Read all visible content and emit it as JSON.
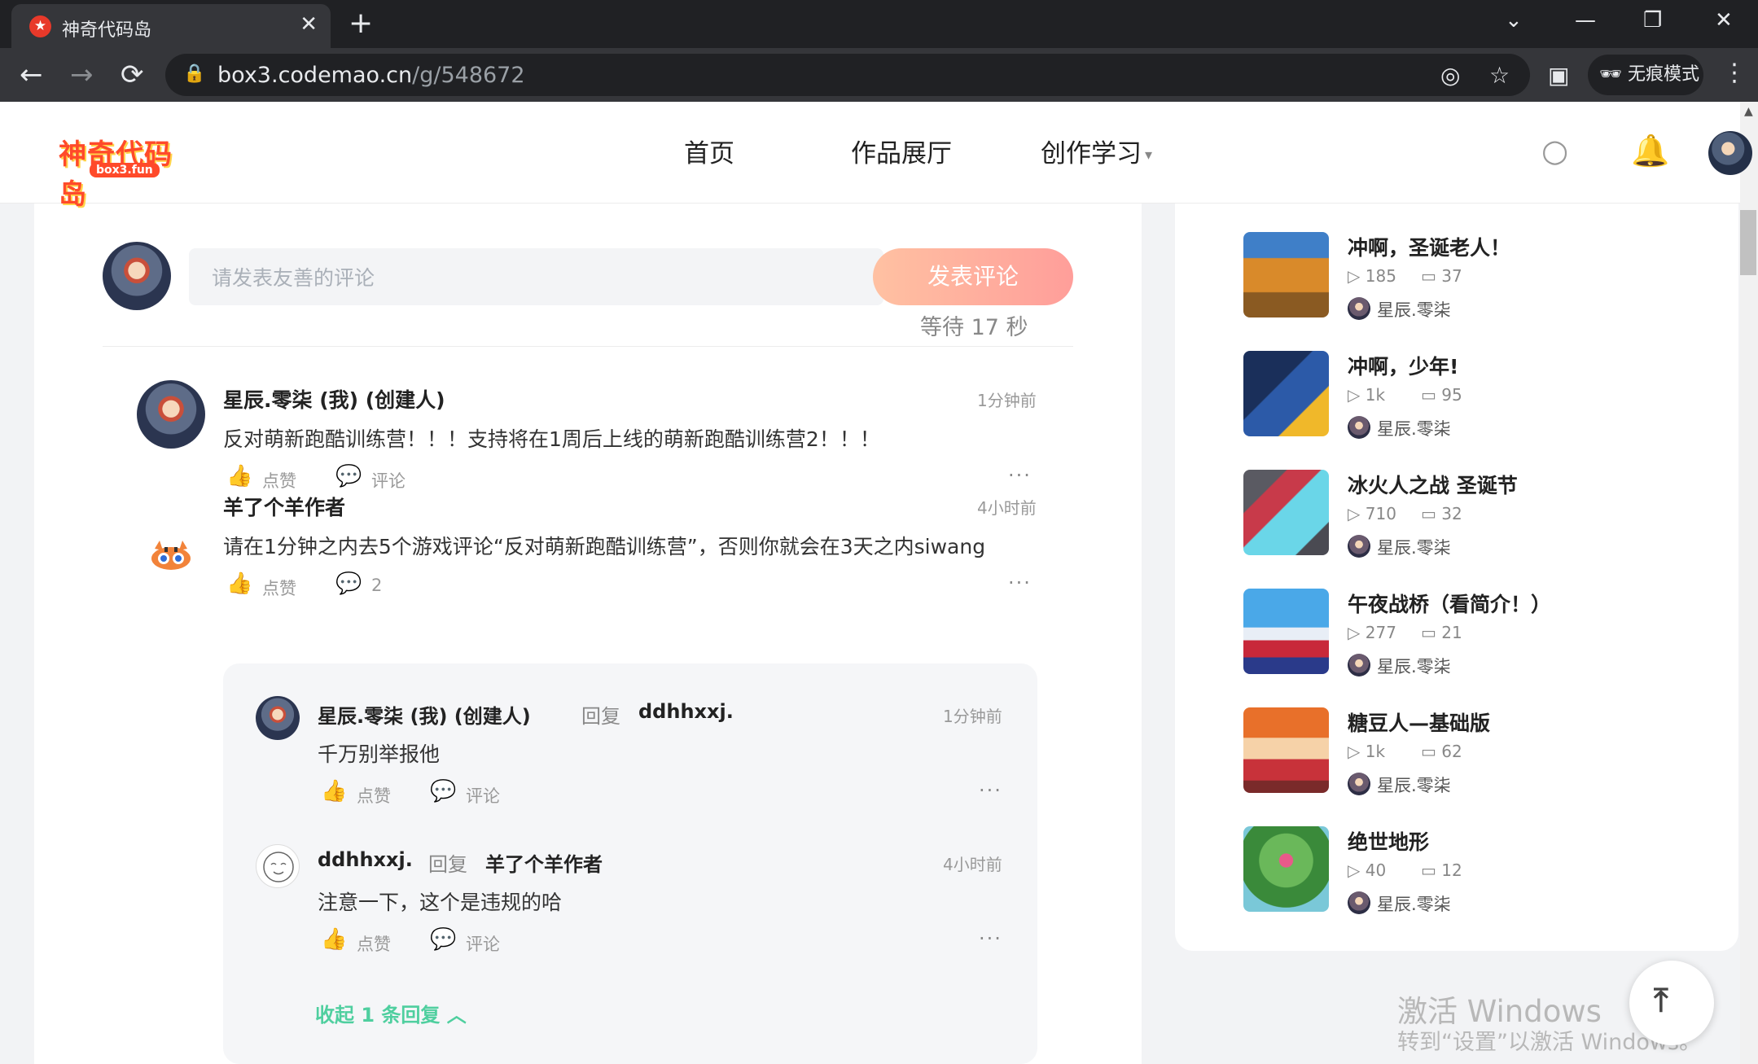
{
  "browser": {
    "tab_title": "神奇代码岛",
    "tab_favicon": "★",
    "new_tab": "+",
    "close_tab": "✕",
    "url_host": "box3.codemao.cn",
    "url_path": "/g/548672",
    "incognito_label": "无痕模式",
    "window_controls": {
      "chevron": "⌄",
      "minimize": "—",
      "restore": "❐",
      "close": "✕"
    },
    "nav": {
      "back": "←",
      "forward": "→",
      "reload": "⟳"
    }
  },
  "header": {
    "logo_text": "神奇代码岛",
    "logo_sub": "box3.fun",
    "nav": [
      {
        "label": "首页"
      },
      {
        "label": "作品展厅"
      },
      {
        "label": "创作学习"
      }
    ],
    "caret": "▾",
    "icons": [
      "search-icon",
      "bell-icon"
    ]
  },
  "comment_form": {
    "placeholder": "请发表友善的评论",
    "submit_label": "发表评论",
    "wait_text": "等待 17 秒"
  },
  "comments": [
    {
      "author": "星辰.零柒 (我) (创建人)",
      "time": "1分钟前",
      "text": "反对萌新跑酷训练营！！！支持将在1周后上线的萌新跑酷训练营2！！！",
      "like_label": "点赞",
      "reply_label": "评论"
    },
    {
      "author": "羊了个羊作者",
      "time": "4小时前",
      "text": "请在1分钟之内去5个游戏评论“反对萌新跑酷训练营”，否则你就会在3天之内siwang",
      "like_label": "点赞",
      "reply_count": "2"
    }
  ],
  "replies": [
    {
      "author": "星辰.零柒 (我) (创建人)",
      "reply_keyword": "回复",
      "target": "ddhhxxj.",
      "time": "1分钟前",
      "text": "千万别举报他",
      "like_label": "点赞",
      "reply_label": "评论"
    },
    {
      "author": "ddhhxxj.",
      "reply_keyword": "回复",
      "target": "羊了个羊作者",
      "time": "4小时前",
      "text": "注意一下，这个是违规的哈",
      "like_label": "点赞",
      "reply_label": "评论"
    }
  ],
  "collapse_label": "收起 1 条回复",
  "more_label": "···",
  "related": [
    {
      "title": "冲啊，圣诞老人！",
      "plays": "185",
      "comments": "37",
      "author": "星辰.零柒"
    },
    {
      "title": "冲啊，少年!",
      "plays": "1k",
      "comments": "95",
      "author": "星辰.零柒"
    },
    {
      "title": "冰火人之战 圣诞节",
      "plays": "710",
      "comments": "32",
      "author": "星辰.零柒"
    },
    {
      "title": "午夜战桥（看简介！）",
      "plays": "277",
      "comments": "21",
      "author": "星辰.零柒"
    },
    {
      "title": "糖豆人—基础版",
      "plays": "1k",
      "comments": "62",
      "author": "星辰.零柒"
    },
    {
      "title": "绝世地形",
      "plays": "40",
      "comments": "12",
      "author": "星辰.零柒"
    }
  ],
  "watermark": {
    "line1": "激活 Windows",
    "line2": "转到“设置”以激活 Windows。"
  }
}
